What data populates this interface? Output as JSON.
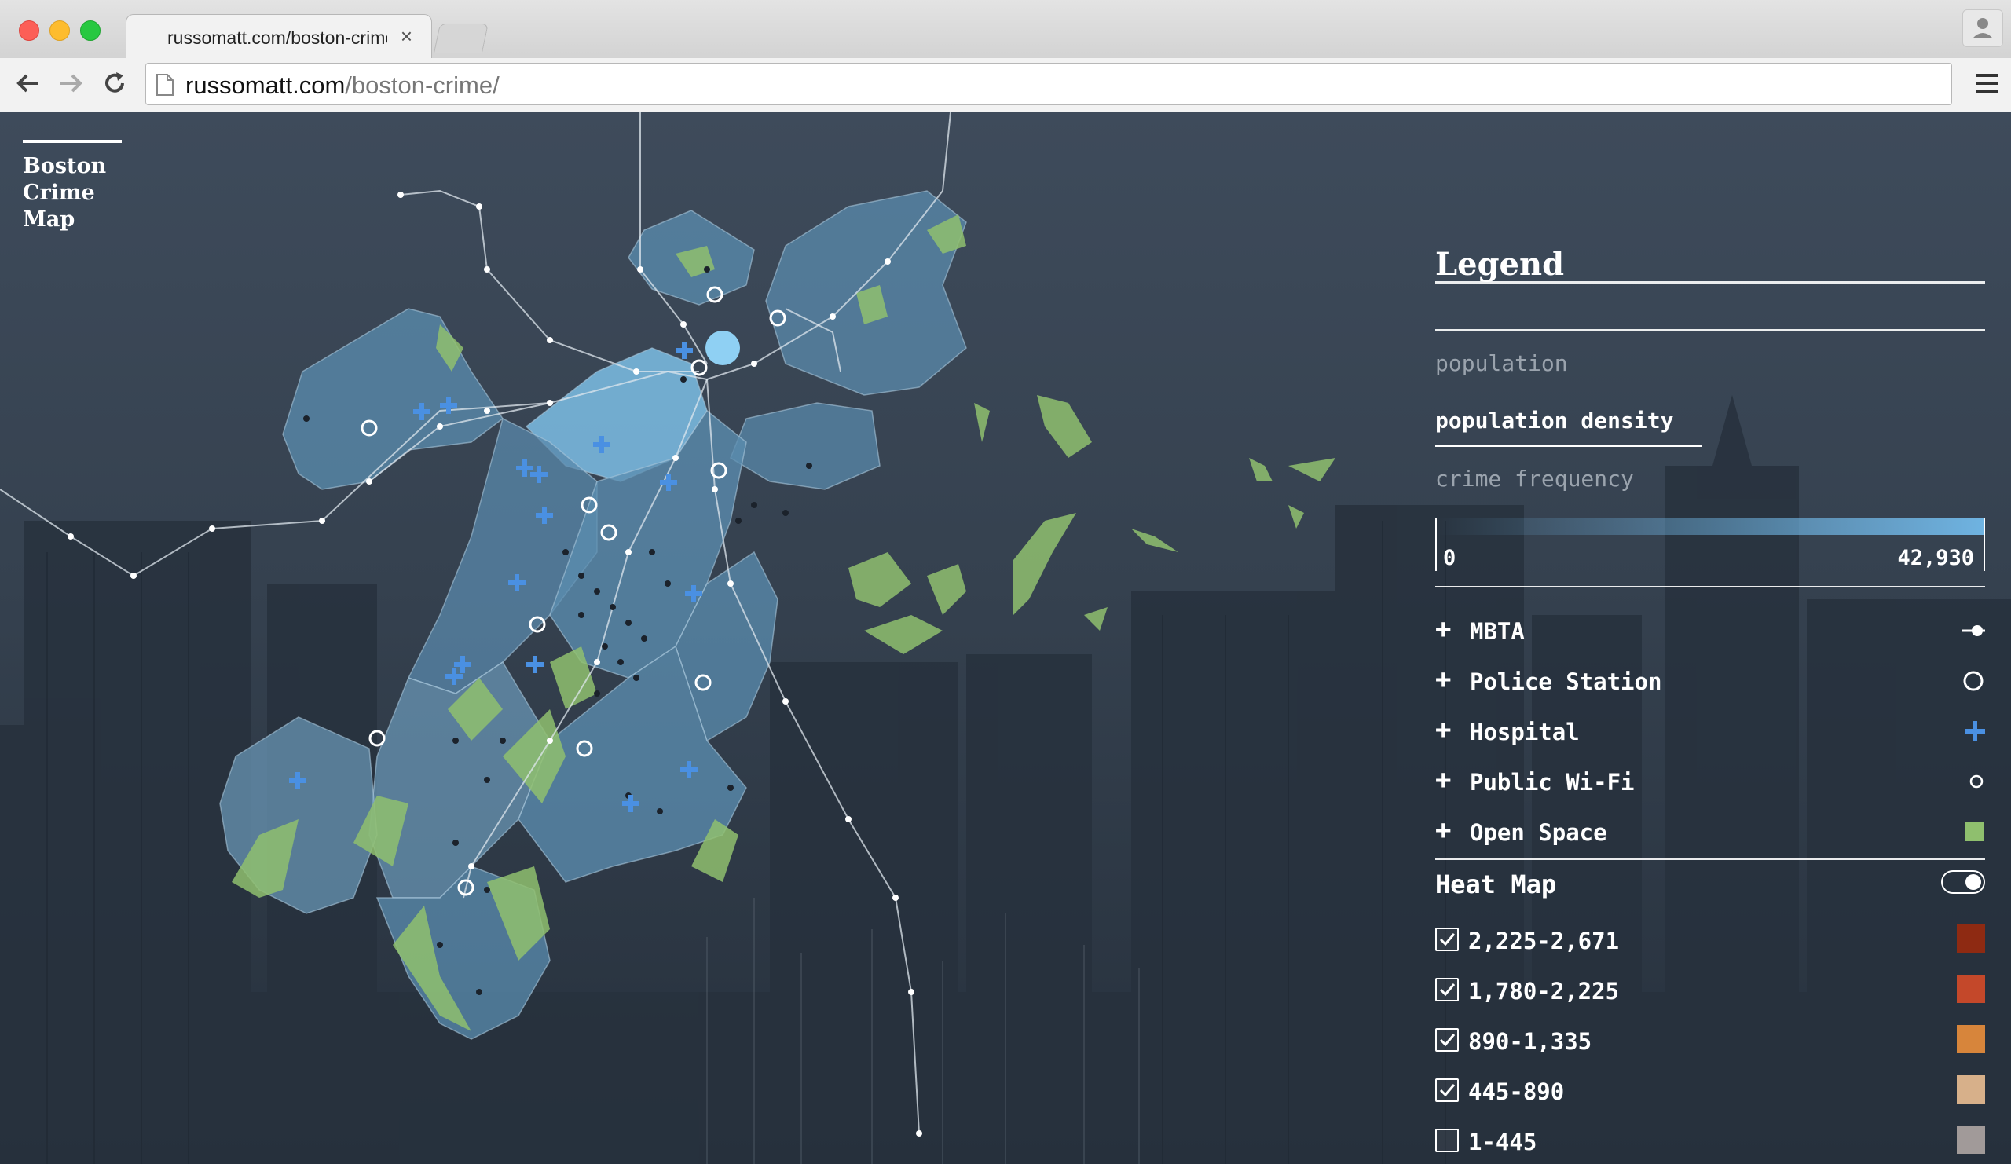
{
  "browser": {
    "tab_title": "russomatt.com/boston-crime/",
    "tab_close": "×",
    "url_host": "russomatt.com",
    "url_path": "/boston-crime/"
  },
  "brand": {
    "line1": "Boston",
    "line2": "Crime",
    "line3": "Map"
  },
  "legend": {
    "title": "Legend",
    "options": [
      "population",
      "population density",
      "crime frequency"
    ],
    "active_option": "population density",
    "scale": {
      "min": "0",
      "max": "42,930",
      "color": "#6fb3e1"
    },
    "layers": [
      {
        "label": "MBTA",
        "symbol": "mbta-line-icon"
      },
      {
        "label": "Police Station",
        "symbol": "ring-icon"
      },
      {
        "label": "Hospital",
        "symbol": "blue-cross-icon",
        "color": "#4a90e2"
      },
      {
        "label": "Public Wi-Fi",
        "symbol": "small-ring-icon"
      },
      {
        "label": "Open Space",
        "symbol": "green-square-icon",
        "color": "#8fbf6e"
      }
    ],
    "plus": "+",
    "heat_map": {
      "title": "Heat Map",
      "toggle_on": false,
      "ranges": [
        {
          "label": "2,225-2,671",
          "checked": true,
          "color": "#8e2a12"
        },
        {
          "label": "1,780-2,225",
          "checked": true,
          "color": "#c4482a"
        },
        {
          "label": "890-1,335",
          "checked": true,
          "color": "#d7853b"
        },
        {
          "label": "445-890",
          "checked": true,
          "color": "#d7b08a"
        },
        {
          "label": "1-445",
          "checked": false,
          "color": "#a19a99"
        }
      ]
    }
  },
  "map": {
    "land_color": "#6ea7c9",
    "open_space_color": "#8fbf6e",
    "hospital_color": "#4a90e2"
  }
}
